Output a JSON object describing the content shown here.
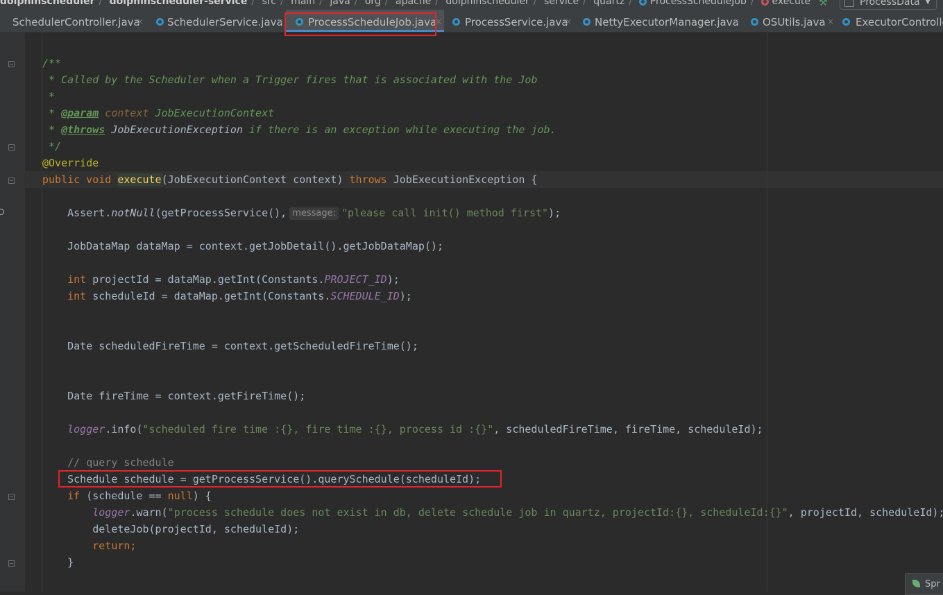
{
  "breadcrumb": {
    "items": [
      "dolphinscheduler",
      "dolphinscheduler-service",
      "src",
      "main",
      "java",
      "org",
      "apache",
      "dolphinscheduler",
      "service",
      "quartz",
      "ProcessScheduleJob",
      "execute"
    ]
  },
  "run_config": {
    "label": "ProcessData"
  },
  "tabs": [
    {
      "label": "SchedulerController.java",
      "active": false
    },
    {
      "label": "SchedulerService.java",
      "active": false
    },
    {
      "label": "ProcessScheduleJob.java",
      "active": true
    },
    {
      "label": "ProcessService.java",
      "active": false
    },
    {
      "label": "NettyExecutorManager.java",
      "active": false
    },
    {
      "label": "OSUtils.java",
      "active": false
    },
    {
      "label": "ExecutorControlle",
      "active": false
    }
  ],
  "tab_close_glyph": "×",
  "code": {
    "l1": "/**",
    "l2": " * Called by the Scheduler when a Trigger fires that is associated with the Job",
    "l3": " *",
    "l4_a": " * ",
    "l4_tag": "@param",
    "l4_b": " context",
    "l4_c": " JobExecutionContext",
    "l5_a": " * ",
    "l5_tag": "@throws",
    "l5_b": " JobExecutionException",
    "l5_c": " if there is an exception while executing the job.",
    "l6": " */",
    "l7": "@Override",
    "l8_kw": "public void ",
    "l8_name": "execute",
    "l8_params": "(JobExecutionContext context) ",
    "l8_throws": "throws",
    "l8_rest": " JobExecutionException {",
    "l9_a": "    Assert.",
    "l9_m": "notNull",
    "l9_b": "(getProcessService(),",
    "l9_hint": "message:",
    "l9_str": "\"please call init() method first\"",
    "l9_c": ");",
    "l10": "    JobDataMap dataMap = context.getJobDetail().getJobDataMap();",
    "l11_kw": "    int",
    "l11_a": " projectId = dataMap.getInt(Constants.",
    "l11_f": "PROJECT_ID",
    "l11_b": ");",
    "l12_kw": "    int",
    "l12_a": " scheduleId = dataMap.getInt(Constants.",
    "l12_f": "SCHEDULE_ID",
    "l12_b": ");",
    "l13": "    Date scheduledFireTime = context.getScheduledFireTime();",
    "l14": "    Date fireTime = context.getFireTime();",
    "l15_f": "    logger",
    "l15_a": ".info(",
    "l15_s": "\"scheduled fire time :{}, fire time :{}, process id :{}\"",
    "l15_b": ", scheduledFireTime, fireTime, scheduleId);",
    "l16": "    // query schedule",
    "l17": "    Schedule schedule = getProcessService().querySchedule(scheduleId);",
    "l18_kw": "    if",
    "l18_a": " (schedule == ",
    "l18_null": "null",
    "l18_b": ") {",
    "l19_f": "        logger",
    "l19_a": ".warn(",
    "l19_s": "\"process schedule does not exist in db, delete schedule job in quartz, projectId:{}, scheduleId:{}\"",
    "l19_b": ", projectId, scheduleId);",
    "l20": "        deleteJob(projectId, scheduleId);",
    "l21": "        return;",
    "l22": "    }"
  },
  "spring_button": {
    "label": "Spr"
  },
  "colors": {
    "highlight_box": "#e0262c",
    "background": "#2b2b2b",
    "comment": "#629755",
    "keyword": "#cc7832",
    "string": "#6a8759"
  }
}
